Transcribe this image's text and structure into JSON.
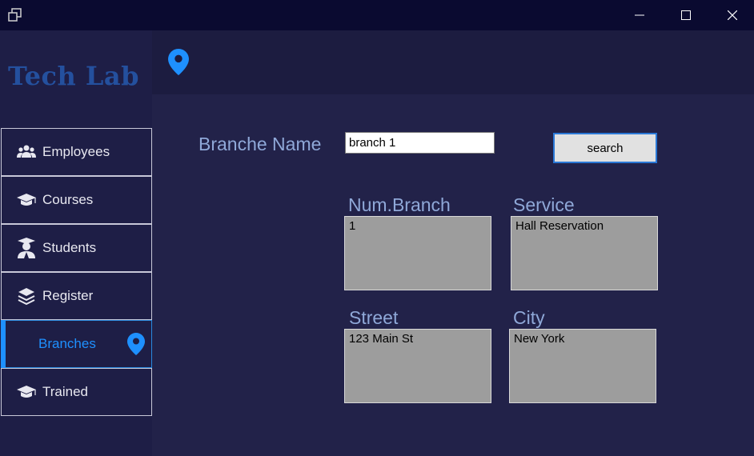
{
  "window": {
    "icons": {
      "app": "restore-window-icon",
      "minimize": "minimize-icon",
      "maximize": "maximize-icon",
      "close": "close-icon"
    }
  },
  "logo": "Tech Lab",
  "sidebar": {
    "items": [
      {
        "label": "Employees",
        "icon": "users-icon"
      },
      {
        "label": "Courses",
        "icon": "graduation-cap-icon"
      },
      {
        "label": "Students",
        "icon": "student-icon"
      },
      {
        "label": "Register",
        "icon": "layers-icon"
      },
      {
        "label": "Branches",
        "icon": "map-pin-icon",
        "active": true
      },
      {
        "label": "Trained",
        "icon": "graduation-cap-icon"
      }
    ]
  },
  "header": {
    "icon": "map-pin-icon"
  },
  "form": {
    "branch_name_label": "Branche Name",
    "branch_name_value": "branch 1",
    "search_label": "search"
  },
  "results": {
    "num_branch_label": "Num.Branch",
    "num_branch_value": "1",
    "service_label": "Service",
    "service_value": "Hall Reservation",
    "street_label": "Street",
    "street_value": "123 Main St",
    "city_label": "City",
    "city_value": "New York"
  },
  "colors": {
    "accent": "#1e90ff",
    "label": "#8fa8d8",
    "background": "#222249",
    "sidebar": "#1e1e46"
  }
}
